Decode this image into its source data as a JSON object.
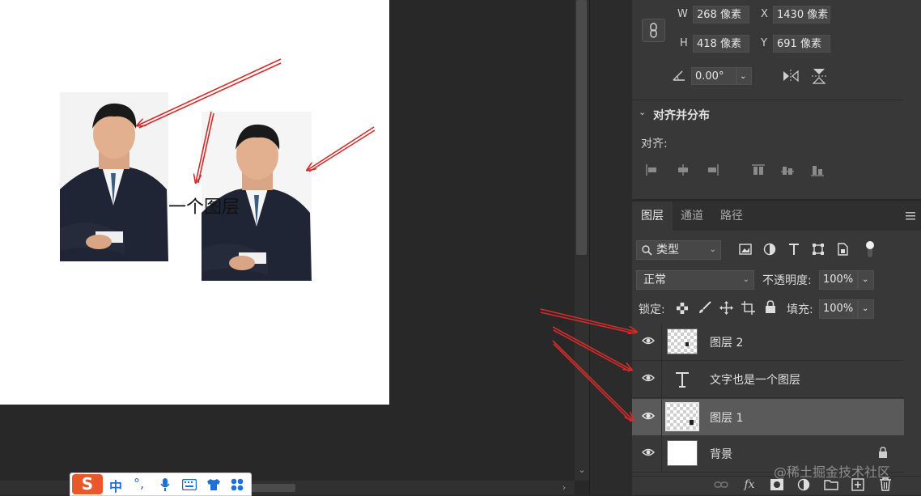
{
  "canvas": {
    "text_layer_content": "一个图层"
  },
  "properties": {
    "w_label": "W",
    "w_value": "268 像素",
    "h_label": "H",
    "h_value": "418 像素",
    "x_label": "X",
    "x_value": "1430 像素",
    "y_label": "Y",
    "y_value": "691 像素",
    "angle_value": "0.00°",
    "align_section_title": "对齐并分布",
    "align_label": "对齐:"
  },
  "layers_panel": {
    "tabs": [
      {
        "label": "图层",
        "active": true
      },
      {
        "label": "通道",
        "active": false
      },
      {
        "label": "路径",
        "active": false
      }
    ],
    "filter_dropdown": "类型",
    "blend_mode": "正常",
    "opacity_label": "不透明度:",
    "opacity_value": "100%",
    "lock_label": "锁定:",
    "fill_label": "填充:",
    "fill_value": "100%",
    "layers": [
      {
        "name": "图层 2",
        "kind": "pixel",
        "selected": false
      },
      {
        "name": "文字也是一个图层",
        "kind": "text",
        "selected": false
      },
      {
        "name": "图层 1",
        "kind": "pixel",
        "selected": true
      },
      {
        "name": "背景",
        "kind": "background",
        "selected": false
      }
    ],
    "bottom_icons": [
      "link-icon",
      "fx-icon",
      "mask-icon",
      "adjustment-icon",
      "folder-icon",
      "new-layer-icon",
      "trash-icon"
    ],
    "fx_label": "fx"
  },
  "ime_toolbar": {
    "logo": "S",
    "mode": "中",
    "punct": "°,",
    "icons": [
      "mic-icon",
      "keyboard-icon",
      "shirt-icon",
      "apps-icon"
    ]
  },
  "watermark": "@稀土掘金技术社区",
  "colors": {
    "annotation_arrow": "#d42b2b",
    "panel_bg": "#383838",
    "selected_row": "#5a5a5a"
  }
}
